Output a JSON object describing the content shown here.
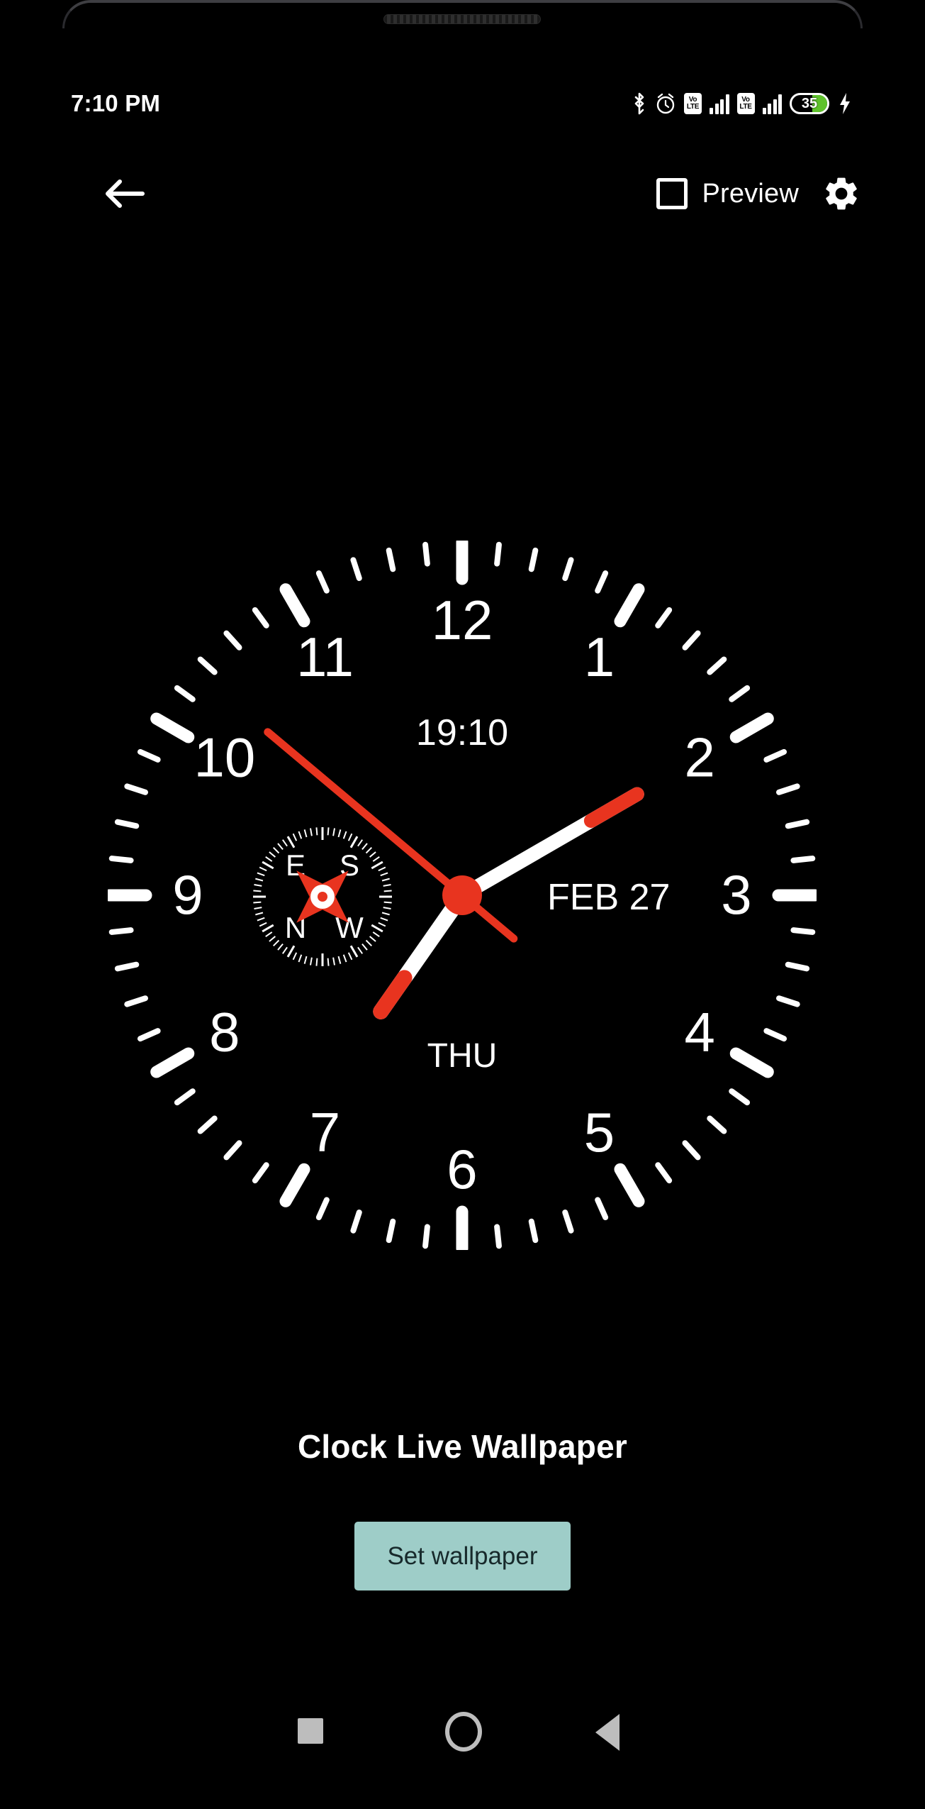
{
  "status_bar": {
    "time": "7:10 PM",
    "icons": [
      {
        "name": "bluetooth-icon",
        "label": "Bluetooth"
      },
      {
        "name": "alarm-icon",
        "label": "Alarm"
      },
      {
        "name": "volte-icon-sim1",
        "label": "VoLTE",
        "line1": "Vo",
        "line2": "LTE"
      },
      {
        "name": "signal-icon-sim1",
        "label": "Signal"
      },
      {
        "name": "volte-icon-sim2",
        "label": "VoLTE",
        "line1": "Vo",
        "line2": "LTE"
      },
      {
        "name": "signal-icon-sim2",
        "label": "Signal"
      },
      {
        "name": "battery-icon",
        "label": "Battery"
      },
      {
        "name": "charging-bolt-icon",
        "label": "Charging"
      }
    ],
    "battery_level": "35",
    "battery_fill_color": "#5fc22c",
    "charging": true
  },
  "action_bar": {
    "back_label": "Back",
    "preview_label": "Preview",
    "preview_checked": false,
    "settings_label": "Settings"
  },
  "clock": {
    "digital_time": "19:10",
    "date": "FEB 27",
    "weekday": "THU",
    "hour_numerals": [
      "1",
      "2",
      "3",
      "4",
      "5",
      "6",
      "7",
      "8",
      "9",
      "10",
      "11",
      "12"
    ],
    "hour_hand_angle": 215,
    "minute_hand_angle": 60,
    "second_hand_angle": 310,
    "hand_color_red": "#e8341f",
    "hand_color_white": "#ffffff",
    "dial_color": "#000000",
    "tick_color": "#ffffff",
    "compass": {
      "labels": {
        "top_left": "E",
        "top_right": "S",
        "bottom_left": "N",
        "bottom_right": "W"
      },
      "needle_color": "#e8341f",
      "hub_color": "#ffffff"
    }
  },
  "footer": {
    "app_title": "Clock Live Wallpaper",
    "set_wallpaper_label": "Set wallpaper",
    "button_color": "#9ecdc8",
    "button_text_color": "#17292b"
  },
  "nav_bar": {
    "recents_label": "Recents",
    "home_label": "Home",
    "back_label": "Back",
    "icon_color": "#bdbdbd"
  }
}
